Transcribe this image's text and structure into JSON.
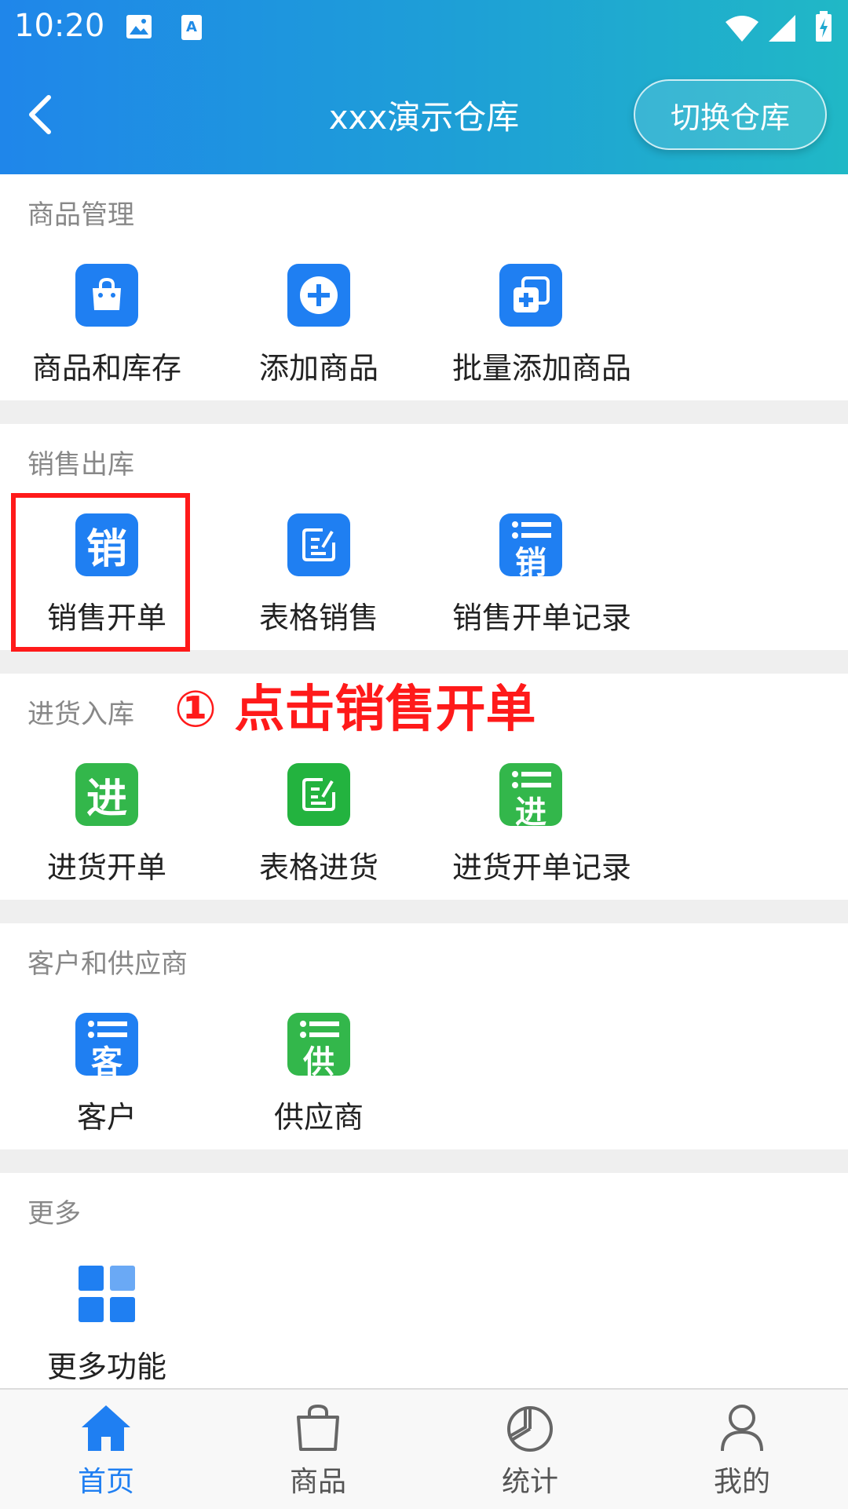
{
  "status_bar": {
    "time": "10:20"
  },
  "header": {
    "title": "xxx演示仓库",
    "switch_label": "切换仓库"
  },
  "sections": [
    {
      "title": "商品管理",
      "items": [
        "商品和库存",
        "添加商品",
        "批量添加商品"
      ]
    },
    {
      "title": "销售出库",
      "items": [
        "销售开单",
        "表格销售",
        "销售开单记录"
      ]
    },
    {
      "title": "进货入库",
      "items": [
        "进货开单",
        "表格进货",
        "进货开单记录"
      ]
    },
    {
      "title": "客户和供应商",
      "items": [
        "客户",
        "供应商"
      ]
    },
    {
      "title": "更多",
      "items": [
        "更多功能"
      ]
    }
  ],
  "icon_chars": {
    "sale": "销",
    "purchase": "进",
    "customer": "客",
    "supplier": "供"
  },
  "annotation": {
    "text": "① 点击销售开单"
  },
  "tabs": [
    {
      "label": "首页",
      "active": true
    },
    {
      "label": "商品",
      "active": false
    },
    {
      "label": "统计",
      "active": false
    },
    {
      "label": "我的",
      "active": false
    }
  ],
  "colors": {
    "accent": "#1f7ff2",
    "green": "#33b74b",
    "highlight": "#ff1a1a"
  }
}
